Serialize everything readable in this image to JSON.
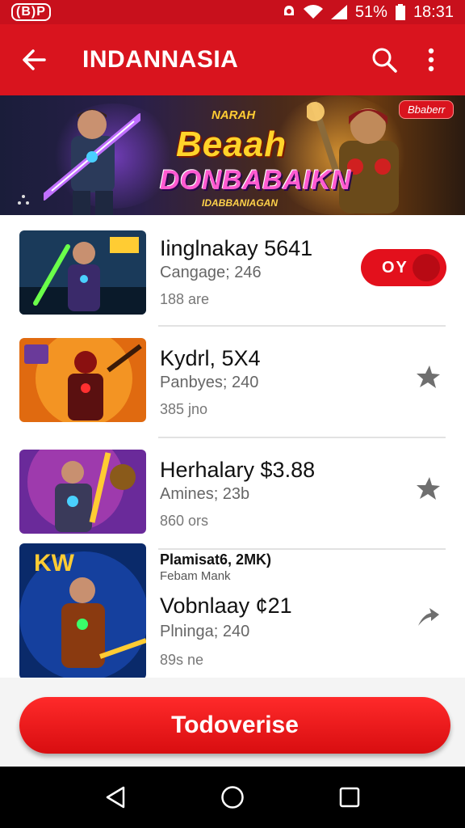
{
  "status_bar": {
    "left_badge": "(B)P",
    "battery_percent": "51%",
    "time": "18:31"
  },
  "app_bar": {
    "title": "INDANNASIA",
    "back_icon": "arrow-left-icon",
    "search_icon": "search-icon",
    "menu_icon": "more-vert-icon"
  },
  "banner": {
    "logo_top": "NARAH",
    "logo_main": "Beaah",
    "logo_sub": "DONBABAIKN",
    "logo_tag": "IDABBANIAGAN",
    "badge": "Bbaberr"
  },
  "items": [
    {
      "name": "Iinglnakay 5641",
      "category": "Cangage; 246",
      "size": "188 are",
      "toggle_label": "OY"
    },
    {
      "name": "Kydrl, 5X4",
      "category": "Panbyes; 240",
      "size": "385 jno"
    },
    {
      "name": "Herhalary $3.88",
      "category": "Amines; 23b",
      "size": "860 ors"
    },
    {
      "promo_title": "Plamisat6, 2MK)",
      "promo_sub": "Febam Mank",
      "name": "Vobnlaay ¢21",
      "category": "Plninga; 240",
      "size": "89s ne"
    }
  ],
  "cta": {
    "label": "Todoverise"
  },
  "colors": {
    "accent": "#d9141e",
    "status": "#c8101c"
  }
}
